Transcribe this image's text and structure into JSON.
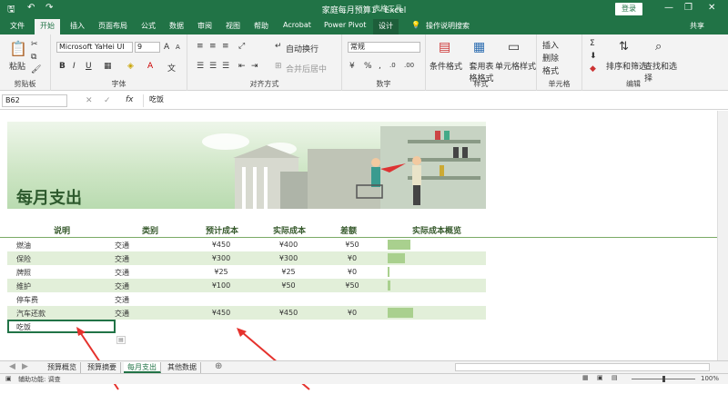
{
  "titlebar": {
    "title": "家庭每月预算1 - Excel",
    "context_tools": "表格工具",
    "login": "登录"
  },
  "tabs": [
    "文件",
    "开始",
    "插入",
    "页面布局",
    "公式",
    "数据",
    "审阅",
    "视图",
    "帮助",
    "Acrobat",
    "Power Pivot",
    "设计"
  ],
  "tell_me": "操作说明搜索",
  "share": "共享",
  "ribbon": {
    "paste": "粘贴",
    "clipboard": "剪贴板",
    "font_name": "Microsoft YaHei UI",
    "font_size": "9",
    "font_group": "字体",
    "wrap": "自动换行",
    "merge": "合并后居中",
    "align_group": "对齐方式",
    "number_format": "常规",
    "number_group": "数字",
    "cond_format": "条件格式",
    "table_format": "套用表格格式",
    "cell_style": "单元格样式",
    "styles_group": "样式",
    "insert": "插入",
    "delete": "删除",
    "format": "格式",
    "cells_group": "单元格",
    "sort_filter": "排序和筛选",
    "find_select": "查找和选择",
    "edit_group": "编辑"
  },
  "formula_bar": {
    "name_box": "B62",
    "fx": "fx",
    "value": "吃饭"
  },
  "sheet": {
    "banner_title": "每月支出",
    "headers": [
      "说明",
      "类别",
      "预计成本",
      "实际成本",
      "差额",
      "实际成本概览"
    ],
    "rows": [
      {
        "desc": "燃油",
        "cat": "交通",
        "est": "¥450",
        "act": "¥400",
        "diff": "¥50",
        "bar": 400
      },
      {
        "desc": "保险",
        "cat": "交通",
        "est": "¥300",
        "act": "¥300",
        "diff": "¥0",
        "bar": 300
      },
      {
        "desc": "牌照",
        "cat": "交通",
        "est": "¥25",
        "act": "¥25",
        "diff": "¥0",
        "bar": 25
      },
      {
        "desc": "维护",
        "cat": "交通",
        "est": "¥100",
        "act": "¥50",
        "diff": "¥50",
        "bar": 50
      },
      {
        "desc": "停车费",
        "cat": "交通",
        "est": "",
        "act": "",
        "diff": "",
        "bar": 0
      },
      {
        "desc": "汽车还款",
        "cat": "交通",
        "est": "¥450",
        "act": "¥450",
        "diff": "¥0",
        "bar": 450
      },
      {
        "desc": "吃饭",
        "cat": "",
        "est": "",
        "act": "",
        "diff": "",
        "bar": 0
      }
    ]
  },
  "sheet_tabs": [
    "预算概览",
    "预算摘要",
    "每月支出",
    "其他数据"
  ],
  "status": {
    "accessibility": "辅助功能: 调查",
    "zoom": "100%"
  },
  "colors": {
    "accent": "#217346",
    "bar": "#a9d08e",
    "annotation": "#e5322d"
  }
}
